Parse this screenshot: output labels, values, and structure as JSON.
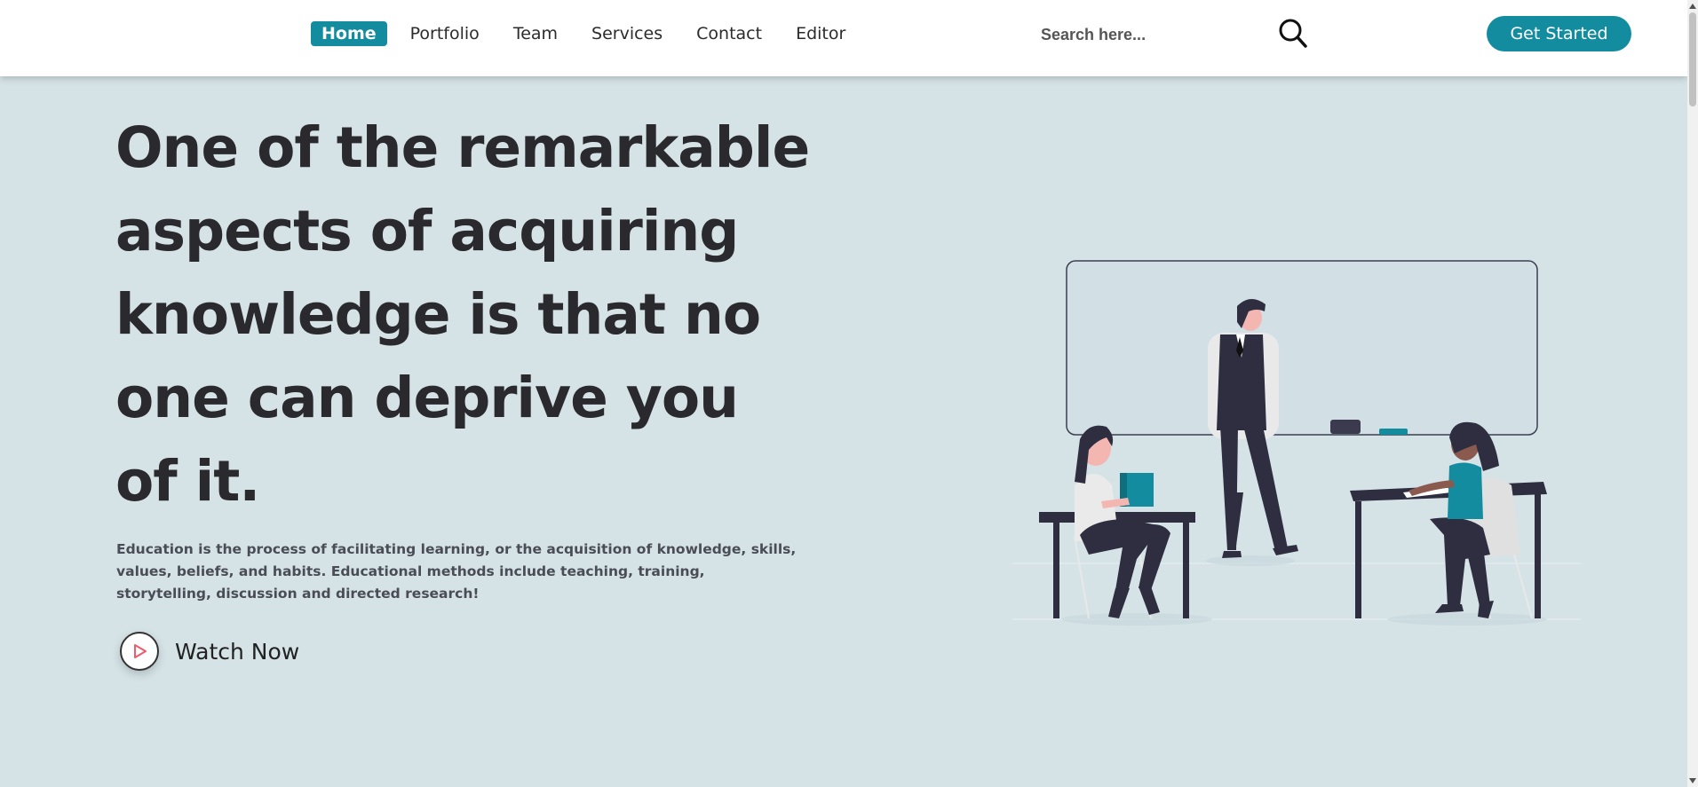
{
  "nav": {
    "items": [
      {
        "label": "Home",
        "active": true
      },
      {
        "label": "Portfolio",
        "active": false
      },
      {
        "label": "Team",
        "active": false
      },
      {
        "label": "Services",
        "active": false
      },
      {
        "label": "Contact",
        "active": false
      },
      {
        "label": "Editor",
        "active": false
      }
    ],
    "search_placeholder": "Search here...",
    "search_icon": "search-icon",
    "cta_label": "Get Started"
  },
  "hero": {
    "title": "One of the remarkable aspects of acquiring knowledge is that no one can deprive you of it.",
    "description": "Education is the process of facilitating learning, or the acquisition of knowledge, skills, values, beliefs, and habits. Educational methods include teaching, training, storytelling, discussion and directed research!",
    "watch_label": "Watch Now",
    "play_icon": "play-icon",
    "illustration": "classroom-illustration"
  },
  "colors": {
    "accent": "#138c9f",
    "background": "#d5e3e7",
    "heading": "#2a2a2e",
    "play_icon": "#f05a6a"
  }
}
